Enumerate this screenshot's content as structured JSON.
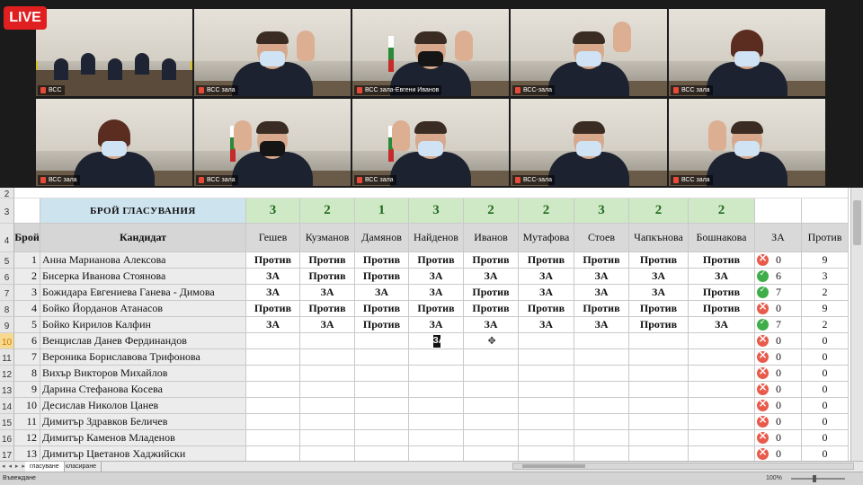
{
  "stream": {
    "live_label": "LIVE"
  },
  "videos": [
    {
      "label": "ВСС",
      "kind": "room"
    },
    {
      "label": "ВСС зала",
      "kind": "hand-right"
    },
    {
      "label": "ВСС зала-Евгени Иванов",
      "kind": "hand-right-dark"
    },
    {
      "label": "ВСС-зала",
      "kind": "hand-up"
    },
    {
      "label": "ВСС зала",
      "kind": "woman"
    },
    {
      "label": "ВСС зала",
      "kind": "woman2"
    },
    {
      "label": "ВСС зала",
      "kind": "hand-left-dark"
    },
    {
      "label": "ВСС зала",
      "kind": "hand-left-flag"
    },
    {
      "label": "ВСС-зала",
      "kind": "man"
    },
    {
      "label": "ВСС зала",
      "kind": "hand-left"
    }
  ],
  "sheet": {
    "row_numbers": [
      "2",
      "3",
      "4",
      "5",
      "6",
      "7",
      "8",
      "9",
      "10",
      "11",
      "12",
      "13",
      "14",
      "15",
      "16",
      "17"
    ],
    "selected_row": "10",
    "votes_count_label": "БРОЙ ГЛАСУВАНИЯ",
    "votes_count": [
      "3",
      "2",
      "1",
      "3",
      "2",
      "2",
      "3",
      "2",
      "2"
    ],
    "col_num_header": "Брой",
    "col_candidate_header": "Кандидат",
    "members": [
      "Гешев",
      "Кузманов",
      "Дамянов",
      "Найденов",
      "Иванов",
      "Мутафова",
      "Стоев",
      "Чапкънова",
      "Бошнакова"
    ],
    "col_for_header": "ЗА",
    "col_against_header": "Против",
    "rows": [
      {
        "n": "1",
        "name": "Анна Марианова Алексова",
        "votes": [
          "Против",
          "Против",
          "Против",
          "Против",
          "Против",
          "Против",
          "Против",
          "Против",
          "Против"
        ],
        "status": "fail",
        "za": "0",
        "against": "9"
      },
      {
        "n": "2",
        "name": "Бисерка Иванова Стоянова",
        "votes": [
          "ЗА",
          "Против",
          "Против",
          "ЗА",
          "ЗА",
          "ЗА",
          "ЗА",
          "ЗА",
          "ЗА"
        ],
        "status": "pass",
        "za": "6",
        "against": "3"
      },
      {
        "n": "3",
        "name": "Божидара Евгениева Ганева - Димова",
        "votes": [
          "ЗА",
          "ЗА",
          "ЗА",
          "ЗА",
          "Против",
          "ЗА",
          "ЗА",
          "ЗА",
          "Против"
        ],
        "status": "pass",
        "za": "7",
        "against": "2"
      },
      {
        "n": "4",
        "name": "Бойко Йорданов Атанасов",
        "votes": [
          "Против",
          "Против",
          "Против",
          "Против",
          "Против",
          "Против",
          "Против",
          "Против",
          "Против"
        ],
        "status": "fail",
        "za": "0",
        "against": "9"
      },
      {
        "n": "5",
        "name": "Бойко Кирилов Калфин",
        "votes": [
          "ЗА",
          "ЗА",
          "Против",
          "ЗА",
          "ЗА",
          "ЗА",
          "ЗА",
          "Против",
          "ЗА"
        ],
        "status": "pass",
        "za": "7",
        "against": "2"
      },
      {
        "n": "6",
        "name": "Венцислав Данев Фердинандов",
        "votes": [
          "",
          "",
          "",
          "ЗА",
          "",
          "",
          "",
          "",
          ""
        ],
        "status": "fail",
        "za": "0",
        "against": "0"
      },
      {
        "n": "7",
        "name": "Вероника Бориславова Трифонова",
        "votes": [
          "",
          "",
          "",
          "",
          "",
          "",
          "",
          "",
          ""
        ],
        "status": "fail",
        "za": "0",
        "against": "0"
      },
      {
        "n": "8",
        "name": "Вихър Викторов Михайлов",
        "votes": [
          "",
          "",
          "",
          "",
          "",
          "",
          "",
          "",
          ""
        ],
        "status": "fail",
        "za": "0",
        "against": "0"
      },
      {
        "n": "9",
        "name": "Дарина Стефанова Косева",
        "votes": [
          "",
          "",
          "",
          "",
          "",
          "",
          "",
          "",
          ""
        ],
        "status": "fail",
        "za": "0",
        "against": "0"
      },
      {
        "n": "10",
        "name": "Десислав Николов Цанев",
        "votes": [
          "",
          "",
          "",
          "",
          "",
          "",
          "",
          "",
          ""
        ],
        "status": "fail",
        "za": "0",
        "against": "0"
      },
      {
        "n": "11",
        "name": "Димитър Здравков Беличев",
        "votes": [
          "",
          "",
          "",
          "",
          "",
          "",
          "",
          "",
          ""
        ],
        "status": "fail",
        "za": "0",
        "against": "0"
      },
      {
        "n": "12",
        "name": "Димитър Каменов Младенов",
        "votes": [
          "",
          "",
          "",
          "",
          "",
          "",
          "",
          "",
          ""
        ],
        "status": "fail",
        "za": "0",
        "against": "0"
      },
      {
        "n": "13",
        "name": "Димитър Цветанов Хаджийски",
        "votes": [
          "",
          "",
          "",
          "",
          "",
          "",
          "",
          "",
          ""
        ],
        "status": "fail",
        "za": "0",
        "against": "0"
      }
    ]
  },
  "tabs": {
    "nav": "◂ ◂ ▸ ▸",
    "items": [
      "гласуване",
      "класиране"
    ]
  },
  "status": {
    "ready": "Въвеждане",
    "zoom": "100%"
  }
}
